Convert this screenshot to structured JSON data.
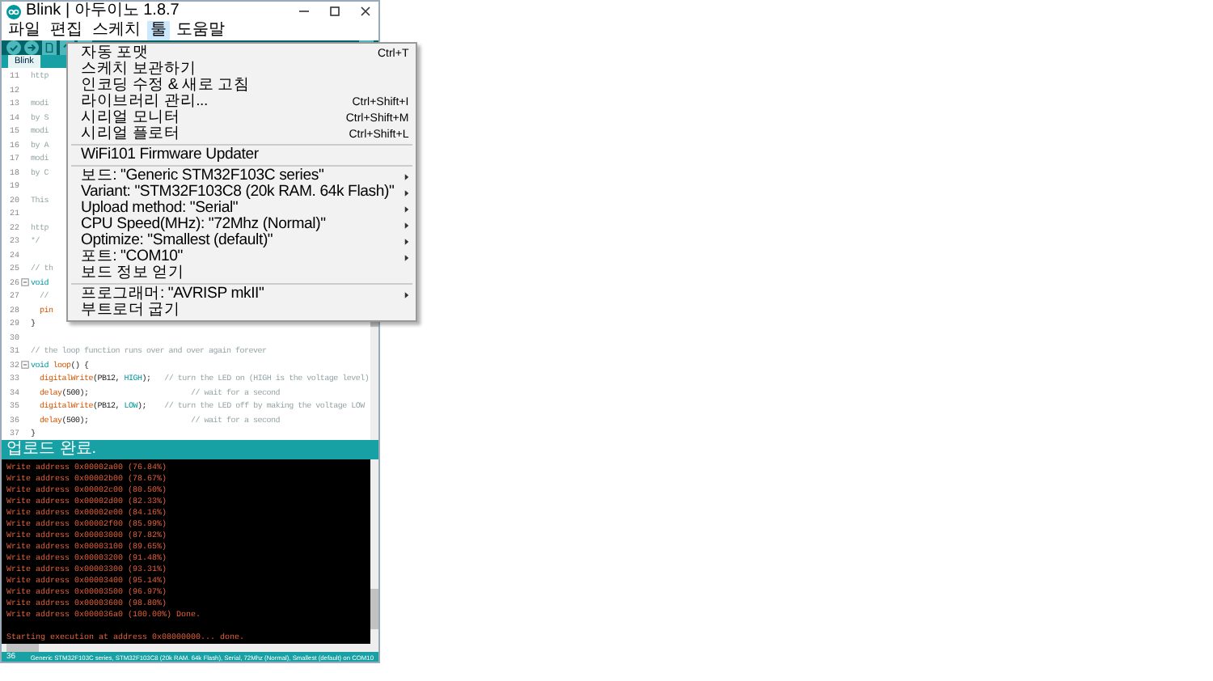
{
  "window": {
    "title": "Blink | 아두이노 1.8.7"
  },
  "menu_bar": [
    {
      "label": "파일",
      "selected": false
    },
    {
      "label": "편집",
      "selected": false
    },
    {
      "label": "스케치",
      "selected": false
    },
    {
      "label": "툴",
      "selected": true
    },
    {
      "label": "도움말",
      "selected": false
    }
  ],
  "tabs": [
    {
      "label": "Blink",
      "selected": true
    }
  ],
  "open_menu": {
    "items": [
      {
        "kind": "item",
        "label": "자동 포맷",
        "shortcut": "Ctrl+T"
      },
      {
        "kind": "item",
        "label": "스케치 보관하기"
      },
      {
        "kind": "item",
        "label": "인코딩 수정 & 새로 고침"
      },
      {
        "kind": "item",
        "label": "라이브러리 관리...",
        "shortcut": "Ctrl+Shift+I"
      },
      {
        "kind": "item",
        "label": "시리얼 모니터",
        "shortcut": "Ctrl+Shift+M"
      },
      {
        "kind": "item",
        "label": "시리얼 플로터",
        "shortcut": "Ctrl+Shift+L"
      },
      {
        "kind": "separator"
      },
      {
        "kind": "item",
        "label": "WiFi101 Firmware Updater"
      },
      {
        "kind": "separator"
      },
      {
        "kind": "submenu",
        "label": "보드: \"Generic STM32F103C series\""
      },
      {
        "kind": "submenu",
        "label": "Variant: \"STM32F103C8 (20k RAM. 64k Flash)\""
      },
      {
        "kind": "submenu",
        "label": "Upload method: \"Serial\""
      },
      {
        "kind": "submenu",
        "label": "CPU Speed(MHz): \"72Mhz (Normal)\""
      },
      {
        "kind": "submenu",
        "label": "Optimize: \"Smallest (default)\""
      },
      {
        "kind": "submenu",
        "label": "포트: \"COM10\""
      },
      {
        "kind": "item",
        "label": "보드 정보 얻기"
      },
      {
        "kind": "separator"
      },
      {
        "kind": "submenu",
        "label": "프로그래머: \"AVRISP mkII\""
      },
      {
        "kind": "item",
        "label": "부트로더 굽기"
      }
    ]
  },
  "editor": {
    "lines": [
      {
        "number": "11",
        "fold": false,
        "tokens": [
          {
            "text": "http",
            "kind": "comment"
          }
        ]
      },
      {
        "number": "12",
        "fold": false
      },
      {
        "number": "13",
        "fold": false,
        "tokens": [
          {
            "text": "modi",
            "kind": "comment"
          }
        ]
      },
      {
        "number": "14",
        "fold": false,
        "tokens": [
          {
            "text": "by S",
            "kind": "comment"
          }
        ]
      },
      {
        "number": "15",
        "fold": false,
        "tokens": [
          {
            "text": "modi",
            "kind": "comment"
          }
        ]
      },
      {
        "number": "16",
        "fold": false,
        "tokens": [
          {
            "text": "by A",
            "kind": "comment"
          }
        ]
      },
      {
        "number": "17",
        "fold": false,
        "tokens": [
          {
            "text": "modi",
            "kind": "comment"
          }
        ]
      },
      {
        "number": "18",
        "fold": false,
        "tokens": [
          {
            "text": "by C",
            "kind": "comment"
          }
        ]
      },
      {
        "number": "19",
        "fold": false
      },
      {
        "number": "20",
        "fold": false,
        "tokens": [
          {
            "text": "This",
            "kind": "comment"
          }
        ]
      },
      {
        "number": "21",
        "fold": false
      },
      {
        "number": "22",
        "fold": false,
        "tokens": [
          {
            "text": "http",
            "kind": "comment"
          }
        ]
      },
      {
        "number": "23",
        "fold": false,
        "tokens": [
          {
            "text": "*/",
            "kind": "comment"
          }
        ]
      },
      {
        "number": "24",
        "fold": false
      },
      {
        "number": "25",
        "fold": false,
        "tokens": [
          {
            "text": "// th",
            "kind": "comment"
          }
        ]
      },
      {
        "number": "26",
        "fold": true,
        "tokens": [
          {
            "text": "void",
            "kind": "keyword"
          }
        ]
      },
      {
        "number": "27",
        "fold": false,
        "tokens": [
          {
            "text": "  //",
            "kind": "comment"
          }
        ]
      },
      {
        "number": "28",
        "fold": false,
        "tokens": [
          {
            "text": "  pin",
            "kind": "function"
          }
        ]
      },
      {
        "number": "29",
        "fold": false,
        "tokens": [
          {
            "text": "}",
            "kind": "plain"
          }
        ]
      },
      {
        "number": "30",
        "fold": false
      },
      {
        "number": "31",
        "fold": false,
        "tokens": [
          {
            "text": "// the loop function runs over and over again forever",
            "kind": "comment"
          }
        ]
      },
      {
        "number": "32",
        "fold": true,
        "tokens": [
          {
            "text": "void ",
            "kind": "keyword"
          },
          {
            "text": "loop",
            "kind": "function"
          },
          {
            "text": "() {",
            "kind": "plain"
          }
        ]
      },
      {
        "number": "33",
        "fold": false,
        "tokens": [
          {
            "text": "  digitalWrite",
            "kind": "function"
          },
          {
            "text": "(PB12, ",
            "kind": "plain"
          },
          {
            "text": "HIGH",
            "kind": "constant"
          },
          {
            "text": ");   ",
            "kind": "plain"
          },
          {
            "text": "// turn the LED on (HIGH is the voltage level)",
            "kind": "comment"
          }
        ]
      },
      {
        "number": "34",
        "fold": false,
        "tokens": [
          {
            "text": "  delay",
            "kind": "function"
          },
          {
            "text": "(500);                       ",
            "kind": "plain"
          },
          {
            "text": "// wait for a second",
            "kind": "comment"
          }
        ]
      },
      {
        "number": "35",
        "fold": false,
        "tokens": [
          {
            "text": "  digitalWrite",
            "kind": "function"
          },
          {
            "text": "(PB12, ",
            "kind": "plain"
          },
          {
            "text": "LOW",
            "kind": "constant"
          },
          {
            "text": ");    ",
            "kind": "plain"
          },
          {
            "text": "// turn the LED off by making the voltage LOW",
            "kind": "comment"
          }
        ]
      },
      {
        "number": "36",
        "fold": false,
        "tokens": [
          {
            "text": "  delay",
            "kind": "function"
          },
          {
            "text": "(500);                       ",
            "kind": "plain"
          },
          {
            "text": "// wait for a second",
            "kind": "comment"
          }
        ]
      },
      {
        "number": "37",
        "fold": false,
        "tokens": [
          {
            "text": "}",
            "kind": "plain"
          }
        ]
      }
    ]
  },
  "console": {
    "header": "업로드 완료.",
    "footer": "Starting execution at address 0x08000000... done.",
    "lines": [
      "Write address 0x00002a00 (76.84%)",
      "Write address 0x00002b00 (78.67%)",
      "Write address 0x00002c00 (80.50%)",
      "Write address 0x00002d00 (82.33%)",
      "Write address 0x00002e00 (84.16%)",
      "Write address 0x00002f00 (85.99%)",
      "Write address 0x00003000 (87.82%)",
      "Write address 0x00003100 (89.65%)",
      "Write address 0x00003200 (91.48%)",
      "Write address 0x00003300 (93.31%)",
      "Write address 0x00003400 (95.14%)",
      "Write address 0x00003500 (96.97%)",
      "Write address 0x00003600 (98.80%)",
      "Write address 0x000036a0 (100.00%) Done."
    ]
  },
  "status_bar": {
    "line": "36",
    "board": "Generic STM32F103C series, STM32F103C8 (20k RAM. 64k Flash), Serial, 72Mhz (Normal), Smallest (default) on COM10"
  }
}
